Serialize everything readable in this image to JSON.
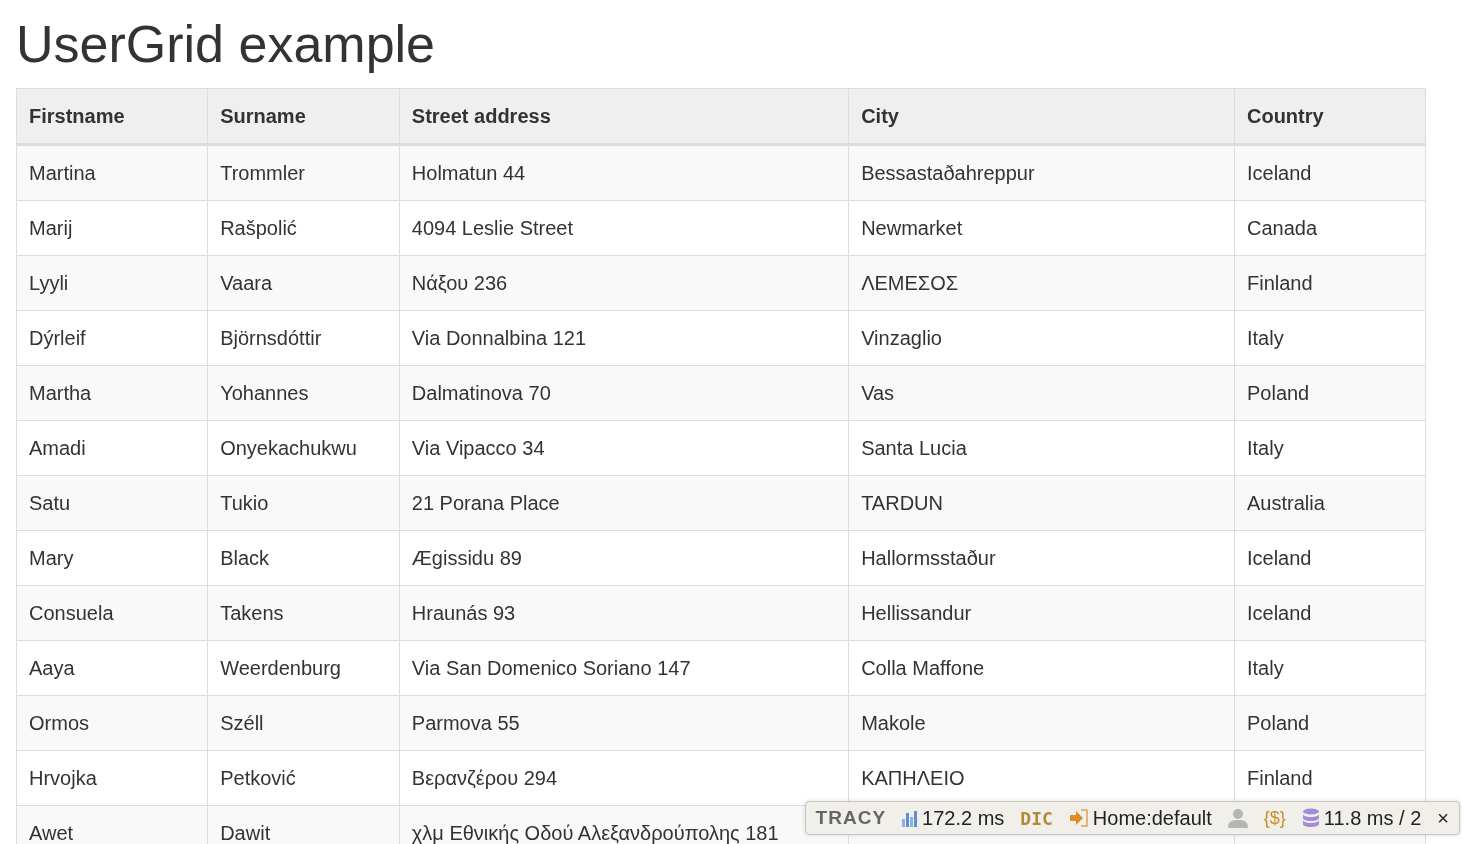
{
  "title": "UserGrid example",
  "table": {
    "columns": [
      "Firstname",
      "Surname",
      "Street address",
      "City",
      "Country"
    ],
    "rows": [
      [
        "Martina",
        "Trommler",
        "Holmatun 44",
        "Bessastaðahreppur",
        "Iceland"
      ],
      [
        "Marij",
        "Rašpolić",
        "4094 Leslie Street",
        "Newmarket",
        "Canada"
      ],
      [
        "Lyyli",
        "Vaara",
        "Νάξου 236",
        "ΛΕΜΕΣΟΣ",
        "Finland"
      ],
      [
        "Dýrleif",
        "Björnsdóttir",
        "Via Donnalbina 121",
        "Vinzaglio",
        "Italy"
      ],
      [
        "Martha",
        "Yohannes",
        "Dalmatinova 70",
        "Vas",
        "Poland"
      ],
      [
        "Amadi",
        "Onyekachukwu",
        "Via Vipacco 34",
        "Santa Lucia",
        "Italy"
      ],
      [
        "Satu",
        "Tukio",
        "21 Porana Place",
        "TARDUN",
        "Australia"
      ],
      [
        "Mary",
        "Black",
        "Ægissidu 89",
        "Hallormsstaður",
        "Iceland"
      ],
      [
        "Consuela",
        "Takens",
        "Hraunás 93",
        "Hellissandur",
        "Iceland"
      ],
      [
        "Aaya",
        "Weerdenburg",
        "Via San Domenico Soriano 147",
        "Colla Maffone",
        "Italy"
      ],
      [
        "Ormos",
        "Széll",
        "Parmova 55",
        "Makole",
        "Poland"
      ],
      [
        "Hrvojka",
        "Petković",
        "Βερανζέρου 294",
        "ΚΑΠΗΛΕΙΟ",
        "Finland"
      ],
      [
        "Awet",
        "Dawit",
        "χλμ Εθνικής Οδού Αλεξανδρούπολης 181"
      ]
    ]
  },
  "debug_bar": {
    "logo": "TRACY",
    "time": "172.2 ms",
    "dic": "DIC",
    "route": "Home:default",
    "session": "{$}",
    "database": "11.8 ms / 2",
    "close": "×"
  }
}
